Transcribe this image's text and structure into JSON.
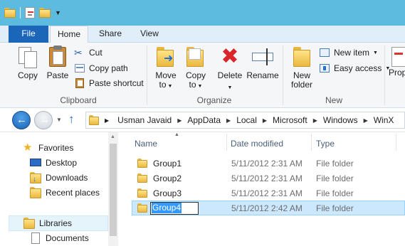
{
  "qat": {
    "icons": [
      "folder-icon",
      "properties-icon",
      "new-folder-icon",
      "customize-qat-icon"
    ]
  },
  "tabs": [
    {
      "label": "File",
      "active": false
    },
    {
      "label": "Home",
      "active": true
    },
    {
      "label": "Share",
      "active": false
    },
    {
      "label": "View",
      "active": false
    }
  ],
  "ribbon": {
    "clipboard": {
      "label": "Clipboard",
      "copy": "Copy",
      "paste": "Paste",
      "cut": "Cut",
      "copy_path": "Copy path",
      "paste_shortcut": "Paste shortcut"
    },
    "organize": {
      "label": "Organize",
      "move_to_1": "Move",
      "move_to_2": "to",
      "copy_to_1": "Copy",
      "copy_to_2": "to",
      "delete": "Delete",
      "rename": "Rename"
    },
    "new": {
      "label": "New",
      "new_folder_1": "New",
      "new_folder_2": "folder",
      "new_item": "New item",
      "easy_access": "Easy access"
    },
    "open": {
      "properties_partial": "Prop"
    }
  },
  "address": {
    "crumbs": [
      "Usman Javaid",
      "AppData",
      "Local",
      "Microsoft",
      "Windows",
      "WinX"
    ]
  },
  "nav": {
    "favorites": "Favorites",
    "desktop": "Desktop",
    "downloads": "Downloads",
    "recent": "Recent places",
    "libraries": "Libraries",
    "documents": "Documents"
  },
  "columns": {
    "name": "Name",
    "date": "Date modified",
    "type": "Type"
  },
  "files": [
    {
      "name": "Group1",
      "date": "5/11/2012 2:31 AM",
      "type": "File folder"
    },
    {
      "name": "Group2",
      "date": "5/11/2012 2:31 AM",
      "type": "File folder"
    },
    {
      "name": "Group3",
      "date": "5/11/2012 2:31 AM",
      "type": "File folder"
    },
    {
      "name": "Group4",
      "date": "5/11/2012 2:42 AM",
      "type": "File folder"
    }
  ],
  "colors": {
    "titlebar": "#5ebbe0",
    "file_tab": "#1b66b9",
    "selection": "#cce8ff",
    "rename_highlight": "#3399ff"
  }
}
